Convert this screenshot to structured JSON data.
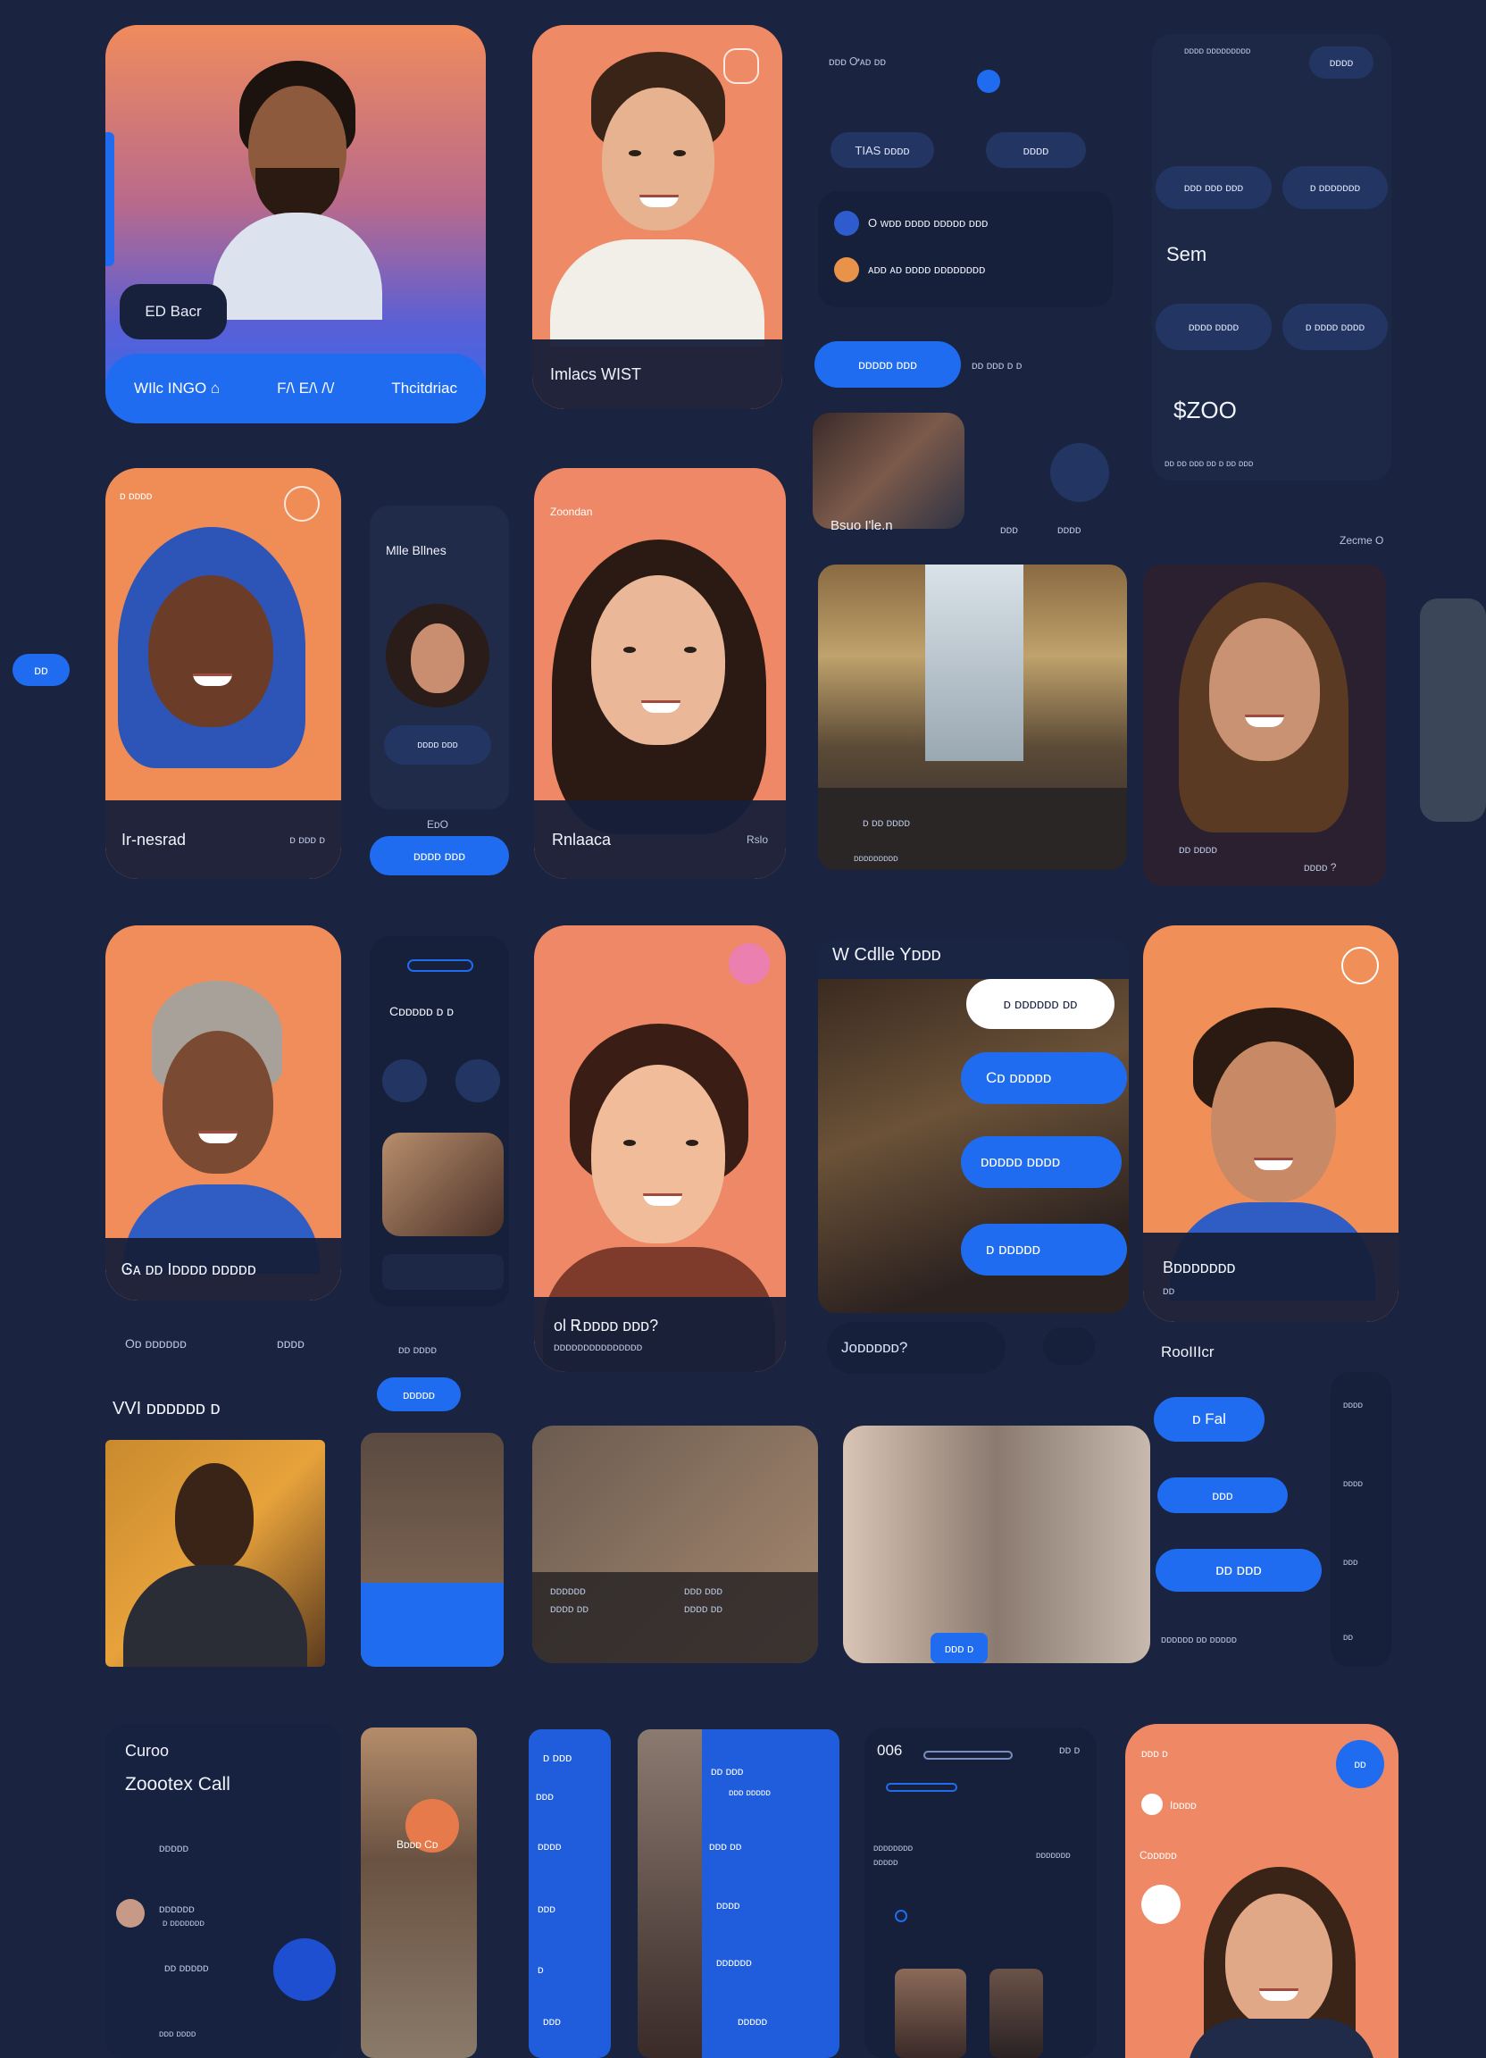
{
  "colors": {
    "background": "#1a2440",
    "accent": "#1f6cf0",
    "card_orange": "#f08d63",
    "panel": "#1f2b49"
  },
  "row1": {
    "card1": {
      "badge": "ED Bacr",
      "actions": [
        "WIlc INGO ⌂",
        "F/\\ E/\\ /\\/",
        "Thcitdriac"
      ]
    },
    "card2": {
      "caption": "Imlacs WIST",
      "dot": "o"
    },
    "panel_a": {
      "header": "ᴅᴅᴅ Ꭴᴀᴅ ᴅᴅ",
      "btn1": "TIAS ᴅᴅᴅᴅ",
      "btn2": "ᴅᴅᴅᴅ",
      "item1": "O ᴡᴅᴅ ᴅᴅᴅᴅ ᴅᴅᴅᴅᴅ ᴅᴅᴅ",
      "item2": "ᴀᴅᴅ ᴀᴅ ᴅᴅᴅᴅ ᴅᴅᴅᴅᴅᴅᴅᴅ",
      "call_btn": "ᴅᴅᴅᴅᴅ ᴅᴅᴅ",
      "meta": "ᴅᴅ ᴅᴅᴅ ᴅ ᴅ"
    },
    "panel_b": {
      "header": "ᴅᴅᴅᴅ ᴅᴅᴅᴅᴅᴅᴅᴅᴅ",
      "header_val": "ᴅᴅᴅᴅ",
      "opt1": "ᴅᴅᴅ ᴅᴅᴅ ᴅᴅᴅ",
      "opt2": "ᴅ ᴅᴅᴅᴅᴅᴅᴅ",
      "amount1": "Sem",
      "opt3": "ᴅᴅᴅᴅ ᴅᴅᴅᴅ",
      "opt4": "ᴅ ᴅᴅᴅᴅ ᴅᴅᴅᴅ",
      "amount2": "$ZOO",
      "footer": "ᴅᴅ ᴅᴅ ᴅᴅᴅ ᴅᴅ ᴅ ᴅᴅ ᴅᴅᴅ"
    }
  },
  "row2": {
    "side_badge": "ᴅᴅ",
    "card3": {
      "label": "Ir-nesrad",
      "meta": "ᴅ ᴅᴅᴅ ᴅ",
      "top": "ᴅ ᴅᴅᴅᴅ"
    },
    "panel_c": {
      "title": "Mlle Bllnes",
      "field": "ᴅᴅᴅᴅ ᴅᴅᴅ",
      "val": "EᴅO",
      "btn": "ᴅᴅᴅᴅ ᴅᴅᴅ"
    },
    "card4": {
      "top": "Zoondan",
      "label": "Rnlaaca",
      "meta": "Rslo"
    },
    "gallery": {
      "caption": "Bsuo I'le.n",
      "meta1": "ᴅᴅᴅ",
      "meta2": "ᴅᴅᴅᴅ",
      "room_label": "ᴅ ᴅᴅ ᴅᴅᴅᴅ",
      "room_meta": "ᴅᴅᴅᴅᴅᴅᴅᴅᴅ",
      "side_top": "Zecme O",
      "side_meta1": "ᴅᴅ ᴅᴅᴅᴅ",
      "side_meta2": "ᴅᴅᴅᴅ ?"
    }
  },
  "row3": {
    "card5": {
      "label": "Ꮆᴀ ᴅᴅ Iᴅᴅᴅᴅ ᴅᴅᴅᴅᴅ",
      "foot_left": "Oᴅ ᴅᴅᴅᴅᴅᴅ",
      "foot_right": "ᴅᴅᴅᴅ"
    },
    "panel_d": {
      "label": "Cᴅᴅᴅᴅᴅ ᴅ ᴅ",
      "foot": "ᴅᴅ ᴅᴅᴅᴅ",
      "btn": "ᴅᴅᴅᴅᴅ"
    },
    "card6": {
      "caption": "ol Ꭱᴅᴅᴅᴅ ᴅᴅᴅ?",
      "sub": "ᴅᴅᴅᴅᴅᴅᴅᴅᴅᴅᴅᴅᴅᴅᴅ"
    },
    "chat": {
      "title": "W Cdlle Yᴅᴅᴅ",
      "bubble1": "ᴅ ᴅᴅᴅᴅᴅᴅ ᴅᴅ",
      "bubble2": "Cᴅ ᴅᴅᴅᴅᴅ",
      "bubble3": "ᴅᴅᴅᴅᴅ ᴅᴅᴅᴅ",
      "bubble4": "ᴅ ᴅᴅᴅᴅᴅ",
      "input": "Joᴅᴅᴅᴅᴅ?"
    },
    "card7": {
      "label": "Bᴅᴅᴅᴅᴅᴅᴅ",
      "sub": "ᴅᴅ"
    }
  },
  "row4": {
    "section_title": "VVI ᴅᴅᴅᴅᴅᴅ ᴅ",
    "card8": {
      "cap1": "ᴅᴅᴅᴅᴅᴅ",
      "cap2": "ᴅᴅᴅᴅ ᴅᴅ",
      "cap3": "ᴅᴅᴅ ᴅᴅᴅ",
      "cap4": "ᴅᴅᴅᴅ ᴅᴅ"
    },
    "pair_tag": "ᴅᴅᴅ ᴅ",
    "side": {
      "title": "RooIIIcr",
      "btn1": "ᴅ Fal",
      "btn2": "ᴅᴅᴅ",
      "btn3": "ᴅᴅ ᴅᴅᴅ",
      "foot": "ᴅᴅᴅᴅᴅᴅ ᴅᴅ ᴅᴅᴅᴅᴅ",
      "nums": [
        "ᴅᴅᴅᴅ",
        "ᴅᴅᴅᴅ",
        "ᴅᴅᴅ",
        "ᴅᴅ"
      ]
    }
  },
  "row5": {
    "call_panel": {
      "line1": "Curoo",
      "line2": "Zoootex Call",
      "item1": "ᴅᴅᴅᴅᴅ",
      "item2": "ᴅᴅᴅᴅᴅᴅ",
      "item2b": "ᴅ ᴅᴅᴅᴅᴅᴅᴅ",
      "item3": "ᴅᴅ ᴅᴅᴅᴅᴅ",
      "item4": "ᴅᴅᴅ ᴅᴅᴅᴅ"
    },
    "strip": {
      "cap": "Bᴅᴅᴅ Cᴅ"
    },
    "blue_col": {
      "title": "ᴅ ᴅᴅᴅ",
      "rows": [
        "ᴅᴅᴅ",
        "ᴅᴅᴅᴅ",
        "ᴅᴅᴅ",
        "ᴅ",
        "ᴅᴅᴅ"
      ]
    },
    "blue_col2": {
      "title": "ᴅᴅ ᴅᴅᴅ",
      "sub": "ᴅᴅᴅ ᴅᴅᴅᴅᴅ",
      "rows": [
        "ᴅᴅᴅ ᴅᴅ",
        "ᴅᴅᴅᴅ",
        "ᴅᴅᴅᴅᴅᴅ",
        "ᴅᴅᴅᴅᴅ"
      ]
    },
    "dark_panel": {
      "top": "006",
      "top_r": "ᴅᴅ ᴅ",
      "mid1": "ᴅᴅᴅᴅᴅᴅᴅᴅ",
      "mid2": "ᴅᴅᴅᴅᴅ",
      "mid3": "ᴅᴅᴅᴅᴅᴅᴅ"
    },
    "card9": {
      "top": "ᴅᴅᴅ ᴅ",
      "item1": "Iᴅᴅᴅᴅ",
      "item2": "Cᴅᴅᴅᴅᴅ",
      "badge": "ᴅᴅ"
    }
  }
}
